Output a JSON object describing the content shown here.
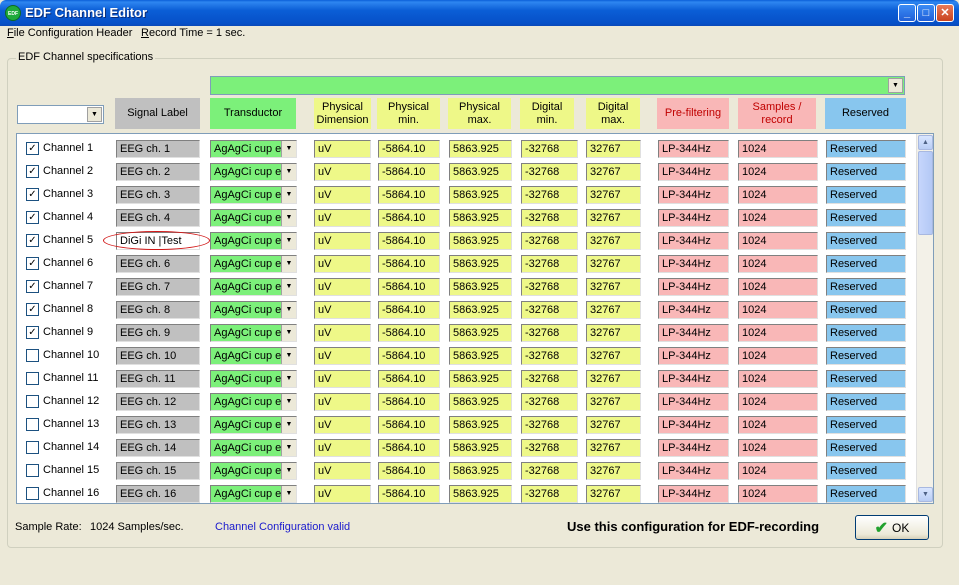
{
  "window": {
    "title": "EDF Channel Editor",
    "icon_text": "EDF",
    "minimize": "_",
    "maximize": "□",
    "close": "✕"
  },
  "menu": {
    "item1_prefix": "F",
    "item1_rest": "ile Configuration Header",
    "item2_prefix": "R",
    "item2_rest": "ecord Time = 1 sec."
  },
  "group": {
    "title": "EDF Channel specifications"
  },
  "headers": {
    "signal_label": "Signal Label",
    "transductor": "Transductor",
    "physical_dimension": "Physical Dimension",
    "physical_min": "Physical min.",
    "physical_max": "Physical max.",
    "digital_min": "Digital min.",
    "digital_max": "Digital max.",
    "prefiltering": "Pre-filtering",
    "samples_record": "Samples / record",
    "reserved": "Reserved"
  },
  "channels": [
    {
      "name": "Channel 1",
      "checked": "✓",
      "label": "EEG ch. 1",
      "transductor": "AgAgCi cup e",
      "dim": "uV",
      "pmin": "-5864.10",
      "pmax": "5863.925",
      "dmin": "-32768",
      "dmax": "32767",
      "prefilter": "LP-344Hz",
      "samples": "1024",
      "reserved": "Reserved"
    },
    {
      "name": "Channel 2",
      "checked": "✓",
      "label": "EEG ch. 2",
      "transductor": "AgAgCi cup e",
      "dim": "uV",
      "pmin": "-5864.10",
      "pmax": "5863.925",
      "dmin": "-32768",
      "dmax": "32767",
      "prefilter": "LP-344Hz",
      "samples": "1024",
      "reserved": "Reserved"
    },
    {
      "name": "Channel 3",
      "checked": "✓",
      "label": "EEG ch. 3",
      "transductor": "AgAgCi cup e",
      "dim": "uV",
      "pmin": "-5864.10",
      "pmax": "5863.925",
      "dmin": "-32768",
      "dmax": "32767",
      "prefilter": "LP-344Hz",
      "samples": "1024",
      "reserved": "Reserved"
    },
    {
      "name": "Channel 4",
      "checked": "✓",
      "label": "EEG ch. 4",
      "transductor": "AgAgCi cup e",
      "dim": "uV",
      "pmin": "-5864.10",
      "pmax": "5863.925",
      "dmin": "-32768",
      "dmax": "32767",
      "prefilter": "LP-344Hz",
      "samples": "1024",
      "reserved": "Reserved"
    },
    {
      "name": "Channel 5",
      "checked": "✓",
      "label": "DiGi IN |Test",
      "transductor": "AgAgCi cup e",
      "dim": "uV",
      "pmin": "-5864.10",
      "pmax": "5863.925",
      "dmin": "-32768",
      "dmax": "32767",
      "prefilter": "LP-344Hz",
      "samples": "1024",
      "reserved": "Reserved"
    },
    {
      "name": "Channel 6",
      "checked": "✓",
      "label": "EEG ch. 6",
      "transductor": "AgAgCi cup e",
      "dim": "uV",
      "pmin": "-5864.10",
      "pmax": "5863.925",
      "dmin": "-32768",
      "dmax": "32767",
      "prefilter": "LP-344Hz",
      "samples": "1024",
      "reserved": "Reserved"
    },
    {
      "name": "Channel 7",
      "checked": "✓",
      "label": "EEG ch. 7",
      "transductor": "AgAgCi cup e",
      "dim": "uV",
      "pmin": "-5864.10",
      "pmax": "5863.925",
      "dmin": "-32768",
      "dmax": "32767",
      "prefilter": "LP-344Hz",
      "samples": "1024",
      "reserved": "Reserved"
    },
    {
      "name": "Channel 8",
      "checked": "✓",
      "label": "EEG ch. 8",
      "transductor": "AgAgCi cup e",
      "dim": "uV",
      "pmin": "-5864.10",
      "pmax": "5863.925",
      "dmin": "-32768",
      "dmax": "32767",
      "prefilter": "LP-344Hz",
      "samples": "1024",
      "reserved": "Reserved"
    },
    {
      "name": "Channel 9",
      "checked": "✓",
      "label": "EEG ch. 9",
      "transductor": "AgAgCi cup e",
      "dim": "uV",
      "pmin": "-5864.10",
      "pmax": "5863.925",
      "dmin": "-32768",
      "dmax": "32767",
      "prefilter": "LP-344Hz",
      "samples": "1024",
      "reserved": "Reserved"
    },
    {
      "name": "Channel 10",
      "checked": "",
      "label": "EEG ch. 10",
      "transductor": "AgAgCi cup e",
      "dim": "uV",
      "pmin": "-5864.10",
      "pmax": "5863.925",
      "dmin": "-32768",
      "dmax": "32767",
      "prefilter": "LP-344Hz",
      "samples": "1024",
      "reserved": "Reserved"
    },
    {
      "name": "Channel 11",
      "checked": "",
      "label": "EEG ch. 11",
      "transductor": "AgAgCi cup e",
      "dim": "uV",
      "pmin": "-5864.10",
      "pmax": "5863.925",
      "dmin": "-32768",
      "dmax": "32767",
      "prefilter": "LP-344Hz",
      "samples": "1024",
      "reserved": "Reserved"
    },
    {
      "name": "Channel 12",
      "checked": "",
      "label": "EEG ch. 12",
      "transductor": "AgAgCi cup e",
      "dim": "uV",
      "pmin": "-5864.10",
      "pmax": "5863.925",
      "dmin": "-32768",
      "dmax": "32767",
      "prefilter": "LP-344Hz",
      "samples": "1024",
      "reserved": "Reserved"
    },
    {
      "name": "Channel 13",
      "checked": "",
      "label": "EEG ch. 13",
      "transductor": "AgAgCi cup e",
      "dim": "uV",
      "pmin": "-5864.10",
      "pmax": "5863.925",
      "dmin": "-32768",
      "dmax": "32767",
      "prefilter": "LP-344Hz",
      "samples": "1024",
      "reserved": "Reserved"
    },
    {
      "name": "Channel 14",
      "checked": "",
      "label": "EEG ch. 14",
      "transductor": "AgAgCi cup e",
      "dim": "uV",
      "pmin": "-5864.10",
      "pmax": "5863.925",
      "dmin": "-32768",
      "dmax": "32767",
      "prefilter": "LP-344Hz",
      "samples": "1024",
      "reserved": "Reserved"
    },
    {
      "name": "Channel 15",
      "checked": "",
      "label": "EEG ch. 15",
      "transductor": "AgAgCi cup e",
      "dim": "uV",
      "pmin": "-5864.10",
      "pmax": "5863.925",
      "dmin": "-32768",
      "dmax": "32767",
      "prefilter": "LP-344Hz",
      "samples": "1024",
      "reserved": "Reserved"
    },
    {
      "name": "Channel 16",
      "checked": "",
      "label": "EEG ch. 16",
      "transductor": "AgAgCi cup e",
      "dim": "uV",
      "pmin": "-5864.10",
      "pmax": "5863.925",
      "dmin": "-32768",
      "dmax": "32767",
      "prefilter": "LP-344Hz",
      "samples": "1024",
      "reserved": "Reserved"
    }
  ],
  "status": {
    "sample_rate_label": "Sample Rate:",
    "sample_rate_value": "1024 Samples/sec.",
    "validity": "Channel Configuration valid",
    "use_config": "Use this configuration for EDF-recording",
    "ok_label": "OK"
  },
  "colors": {
    "label_bg": "#c0c0c0",
    "transductor_bg": "#7cf07a",
    "physical_bg": "#eef888",
    "filter_bg": "#f9b7b7",
    "reserved_bg": "#88c6ee",
    "highlight": "#d21818"
  }
}
